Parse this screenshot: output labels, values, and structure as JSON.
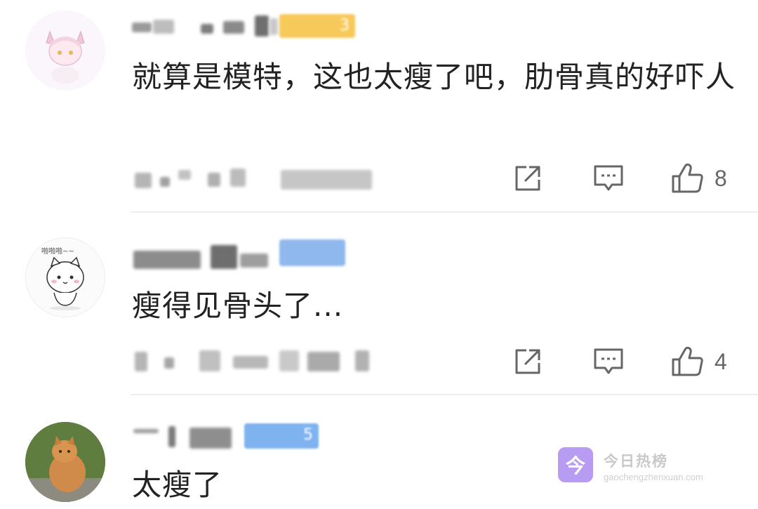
{
  "comments": [
    {
      "text": "就算是模特，这也太瘦了吧，肋骨真的好吓人",
      "likes": "8",
      "badge_text": "3",
      "badge_color": "#f7c95a",
      "avatar": "anime-cat-girl-avatar"
    },
    {
      "text": "瘦得见骨头了...",
      "likes": "4",
      "badge_text": "",
      "badge_color": "#8fb8ee",
      "avatar_caption": "啪啪啪~~",
      "avatar": "white-cartoon-cat-avatar"
    },
    {
      "text": "太瘦了",
      "likes": "",
      "badge_text": "5",
      "badge_color": "#7fb3f0",
      "avatar": "orange-cat-photo-avatar"
    }
  ],
  "icons": {
    "share": "share-icon",
    "reply": "reply-icon",
    "like": "thumbs-up-icon"
  },
  "watermark": {
    "title": "今日热榜",
    "url": "gaochengzhenxuan.com",
    "logo_glyph": "今",
    "logo_color": "#b79cf2"
  }
}
